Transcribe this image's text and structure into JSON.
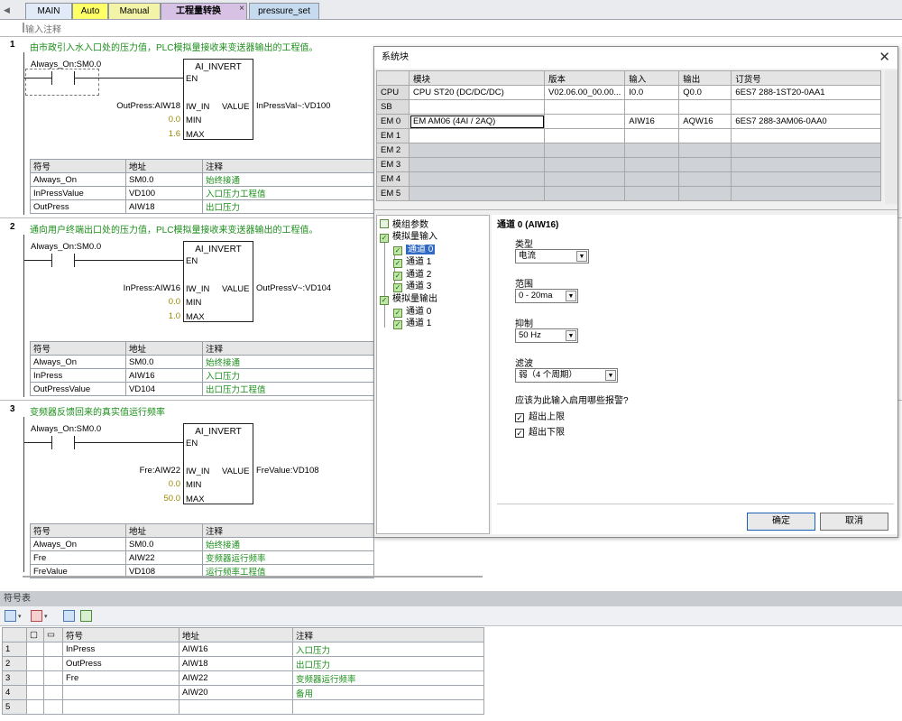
{
  "tabs": [
    {
      "label": "MAIN",
      "bg": "#e1eaf7"
    },
    {
      "label": "Auto",
      "bg": "#ffff66"
    },
    {
      "label": "Manual",
      "bg": "#f3f4a8"
    },
    {
      "label": "工程量转换",
      "bg": "#d7c2e6"
    },
    {
      "label": "pressure_set",
      "bg": "#c6dbf0"
    }
  ],
  "input_comment": "输入注释",
  "networks": [
    {
      "num": "1",
      "comment": "由市政引入水入口处的压力值，PLC模拟量接收来变送器输出的工程值。",
      "contact": "Always_On:SM0.0",
      "block": "AI_INVERT",
      "en": "EN",
      "iw_in": "IW_IN",
      "min": "MIN",
      "max": "MAX",
      "value": "VALUE",
      "in_operand": "OutPress:AIW18",
      "min_val": "0.0",
      "max_val": "1.6",
      "out_operand": "InPressVal~:VD100",
      "symbols": {
        "headers": [
          "符号",
          "地址",
          "注释"
        ],
        "rows": [
          [
            "Always_On",
            "SM0.0",
            "始终接通"
          ],
          [
            "InPressValue",
            "VD100",
            "入口压力工程值"
          ],
          [
            "OutPress",
            "AIW18",
            "出口压力"
          ]
        ]
      }
    },
    {
      "num": "2",
      "comment": "通向用户终端出口处的压力值，PLC模拟量接收来变送器输出的工程值。",
      "contact": "Always_On:SM0.0",
      "block": "AI_INVERT",
      "en": "EN",
      "iw_in": "IW_IN",
      "min": "MIN",
      "max": "MAX",
      "value": "VALUE",
      "in_operand": "InPress:AIW16",
      "min_val": "0.0",
      "max_val": "1.0",
      "out_operand": "OutPressV~:VD104",
      "symbols": {
        "headers": [
          "符号",
          "地址",
          "注释"
        ],
        "rows": [
          [
            "Always_On",
            "SM0.0",
            "始终接通"
          ],
          [
            "InPress",
            "AIW16",
            "入口压力"
          ],
          [
            "OutPressValue",
            "VD104",
            "出口压力工程值"
          ]
        ]
      }
    },
    {
      "num": "3",
      "comment": "变频器反馈回来的真实值运行频率",
      "contact": "Always_On:SM0.0",
      "block": "AI_INVERT",
      "en": "EN",
      "iw_in": "IW_IN",
      "min": "MIN",
      "max": "MAX",
      "value": "VALUE",
      "in_operand": "Fre:AIW22",
      "min_val": "0.0",
      "max_val": "50.0",
      "out_operand": "FreValue:VD108",
      "symbols": {
        "headers": [
          "符号",
          "地址",
          "注释"
        ],
        "rows": [
          [
            "Always_On",
            "SM0.0",
            "始终接通"
          ],
          [
            "Fre",
            "AIW22",
            "变频器运行频率"
          ],
          [
            "FreValue",
            "VD108",
            "运行频率工程值"
          ]
        ]
      }
    }
  ],
  "symbol_pane": {
    "title": "符号表",
    "headers": [
      "符号",
      "地址",
      "注释"
    ],
    "rows": [
      {
        "n": "1",
        "sym": "InPress",
        "addr": "AIW16",
        "cmt": "入口压力"
      },
      {
        "n": "2",
        "sym": "OutPress",
        "addr": "AIW18",
        "cmt": "出口压力"
      },
      {
        "n": "3",
        "sym": "Fre",
        "addr": "AIW22",
        "cmt": "变频器运行频率"
      },
      {
        "n": "4",
        "sym": "",
        "addr": "AIW20",
        "cmt": "备用"
      },
      {
        "n": "5",
        "sym": "",
        "addr": "",
        "cmt": ""
      }
    ]
  },
  "dialog": {
    "title": "系统块",
    "headers": [
      "模块",
      "版本",
      "输入",
      "输出",
      "订货号"
    ],
    "modules": [
      {
        "slot": "CPU",
        "module": "CPU ST20 (DC/DC/DC)",
        "version": "V02.06.00_00.00...",
        "input": "I0.0",
        "output": "Q0.0",
        "order": "6ES7 288-1ST20-0AA1"
      },
      {
        "slot": "SB",
        "module": "",
        "version": "",
        "input": "",
        "output": "",
        "order": ""
      },
      {
        "slot": "EM 0",
        "module": "EM AM06 (4AI / 2AQ)",
        "version": "",
        "input": "AIW16",
        "output": "AQW16",
        "order": "6ES7 288-3AM06-0AA0"
      },
      {
        "slot": "EM 1",
        "module": "",
        "version": "",
        "input": "",
        "output": "",
        "order": ""
      },
      {
        "slot": "EM 2",
        "module": "",
        "version": "",
        "input": "",
        "output": "",
        "order": ""
      },
      {
        "slot": "EM 3",
        "module": "",
        "version": "",
        "input": "",
        "output": "",
        "order": ""
      },
      {
        "slot": "EM 4",
        "module": "",
        "version": "",
        "input": "",
        "output": "",
        "order": ""
      },
      {
        "slot": "EM 5",
        "module": "",
        "version": "",
        "input": "",
        "output": "",
        "order": ""
      }
    ],
    "tree": {
      "module_params": "模组参数",
      "analog_in": "模拟量输入",
      "in_ch": [
        "通道 0",
        "通道 1",
        "通道 2",
        "通道 3"
      ],
      "analog_out": "模拟量输出",
      "out_ch": [
        "通道 0",
        "通道 1"
      ]
    },
    "panel_title": "通道 0 (AIW16)",
    "type_label": "类型",
    "type_value": "电流",
    "range_label": "范围",
    "range_value": "0 - 20ma",
    "reject_label": "抑制",
    "reject_value": "50 Hz",
    "filter_label": "滤波",
    "filter_value": "弱（4 个周期）",
    "alarm_question": "应该为此输入启用哪些报警?",
    "alarm_upper": "超出上限",
    "alarm_lower": "超出下限",
    "ok": "确定",
    "cancel": "取消"
  }
}
